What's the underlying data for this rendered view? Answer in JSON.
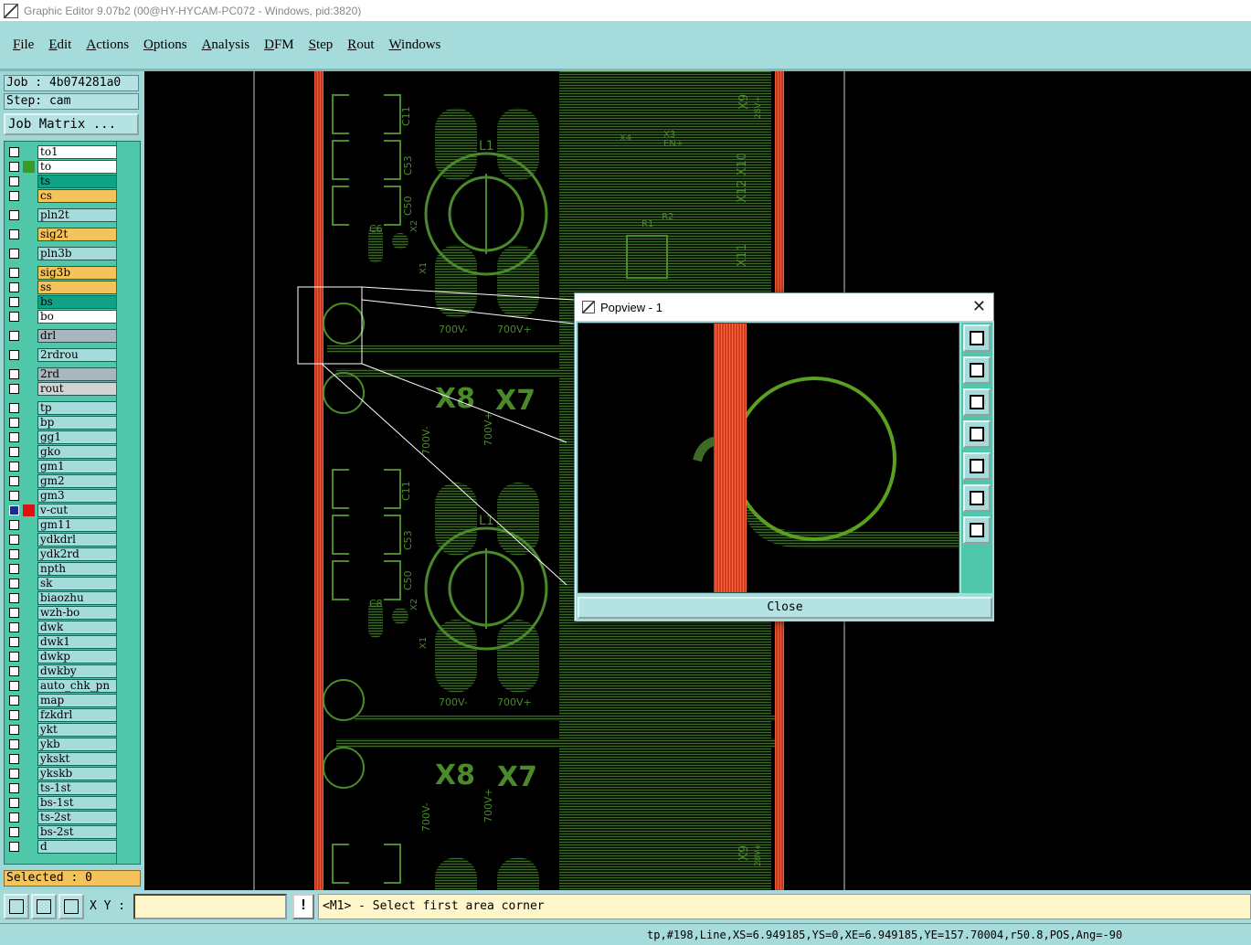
{
  "window": {
    "title": "Graphic Editor 9.07b2 (00@HY-HYCAM-PC072 - Windows, pid:3820)"
  },
  "menu": [
    {
      "label": "File"
    },
    {
      "label": "Edit"
    },
    {
      "label": "Actions"
    },
    {
      "label": "Options"
    },
    {
      "label": "Analysis"
    },
    {
      "label": "DFM"
    },
    {
      "label": "Step"
    },
    {
      "label": "Rout"
    },
    {
      "label": "Windows"
    }
  ],
  "left_panel": {
    "job": "Job : 4b074281a0",
    "step": "Step: cam",
    "job_matrix_label": "Job Matrix ...",
    "selected": "Selected : 0"
  },
  "layers": [
    {
      "name": "to1",
      "style": "white"
    },
    {
      "name": "to",
      "style": "white",
      "mark": "#3c9a2a"
    },
    {
      "name": "ts",
      "style": "teal"
    },
    {
      "name": "cs",
      "style": "orange"
    },
    {
      "name": "pln2t",
      "style": "plain",
      "gap": true
    },
    {
      "name": "sig2t",
      "style": "orange",
      "gap": true
    },
    {
      "name": "pln3b",
      "style": "plain",
      "gap": true
    },
    {
      "name": "sig3b",
      "style": "orange",
      "gap": true
    },
    {
      "name": "ss",
      "style": "orange"
    },
    {
      "name": "bs",
      "style": "teal"
    },
    {
      "name": "bo",
      "style": "white"
    },
    {
      "name": "drl",
      "style": "gray",
      "gap": true
    },
    {
      "name": "2rdrou",
      "style": "plain",
      "gap": true
    },
    {
      "name": "2rd",
      "style": "gray",
      "gap": true
    },
    {
      "name": "rout",
      "style": "lgray"
    },
    {
      "name": "tp",
      "style": "plain",
      "gap": true
    },
    {
      "name": "bp",
      "style": "plain"
    },
    {
      "name": "gg1",
      "style": "plain"
    },
    {
      "name": "gko",
      "style": "plain"
    },
    {
      "name": "gm1",
      "style": "plain"
    },
    {
      "name": "gm2",
      "style": "plain"
    },
    {
      "name": "gm3",
      "style": "plain"
    },
    {
      "name": "v-cut",
      "style": "plain",
      "mark": "#e01010",
      "active": true,
      "dot": true
    },
    {
      "name": "gm11",
      "style": "plain"
    },
    {
      "name": "ydkdrl",
      "style": "plain"
    },
    {
      "name": "ydk2rd",
      "style": "plain"
    },
    {
      "name": "npth",
      "style": "plain"
    },
    {
      "name": "sk",
      "style": "plain"
    },
    {
      "name": "biaozhu",
      "style": "plain"
    },
    {
      "name": "wzh-bo",
      "style": "plain"
    },
    {
      "name": "dwk",
      "style": "plain"
    },
    {
      "name": "dwk1",
      "style": "plain"
    },
    {
      "name": "dwkp",
      "style": "plain"
    },
    {
      "name": "dwkby",
      "style": "plain"
    },
    {
      "name": "auto_chk_pn",
      "style": "plain"
    },
    {
      "name": "map",
      "style": "plain"
    },
    {
      "name": "fzkdrl",
      "style": "plain"
    },
    {
      "name": "ykt",
      "style": "plain"
    },
    {
      "name": "ykb",
      "style": "plain"
    },
    {
      "name": "ykskt",
      "style": "plain"
    },
    {
      "name": "ykskb",
      "style": "plain"
    },
    {
      "name": "ts-1st",
      "style": "plain"
    },
    {
      "name": "bs-1st",
      "style": "plain"
    },
    {
      "name": "ts-2st",
      "style": "plain"
    },
    {
      "name": "bs-2st",
      "style": "plain"
    },
    {
      "name": "d",
      "style": "plain"
    }
  ],
  "canvas": {
    "silk_labels": {
      "l1": "L1",
      "x8": "X8",
      "x7": "X7",
      "x9": "X9",
      "x10": "X12 X10",
      "x11": "X11",
      "c11": "C11",
      "c53": "C53",
      "c50": "C50",
      "c6": "C6",
      "c8": "C8",
      "v700m": "700V-",
      "v700p": "700V+",
      "v28": "28V+",
      "x1": "X1",
      "x2": "X2",
      "x3": "X3",
      "x4": "X4",
      "en": "EN+",
      "r1": "R1",
      "r2": "R2"
    },
    "colors": {
      "background": "#000000",
      "copper": "#4a7a2c",
      "copper_bright": "#5aa020",
      "vcut": "#e8452a",
      "outline": "#ffffff"
    }
  },
  "popview": {
    "title": "Popview - 1",
    "close_label": "Close"
  },
  "bottom": {
    "xy_label": "X Y :",
    "xy_value": "",
    "excl": "!",
    "prompt": "<M1> - Select first area corner"
  },
  "status": {
    "text": "tp,#198,Line,XS=6.949185,YS=0,XE=6.949185,YE=157.70004,r50.8,POS,Ang=-90"
  }
}
